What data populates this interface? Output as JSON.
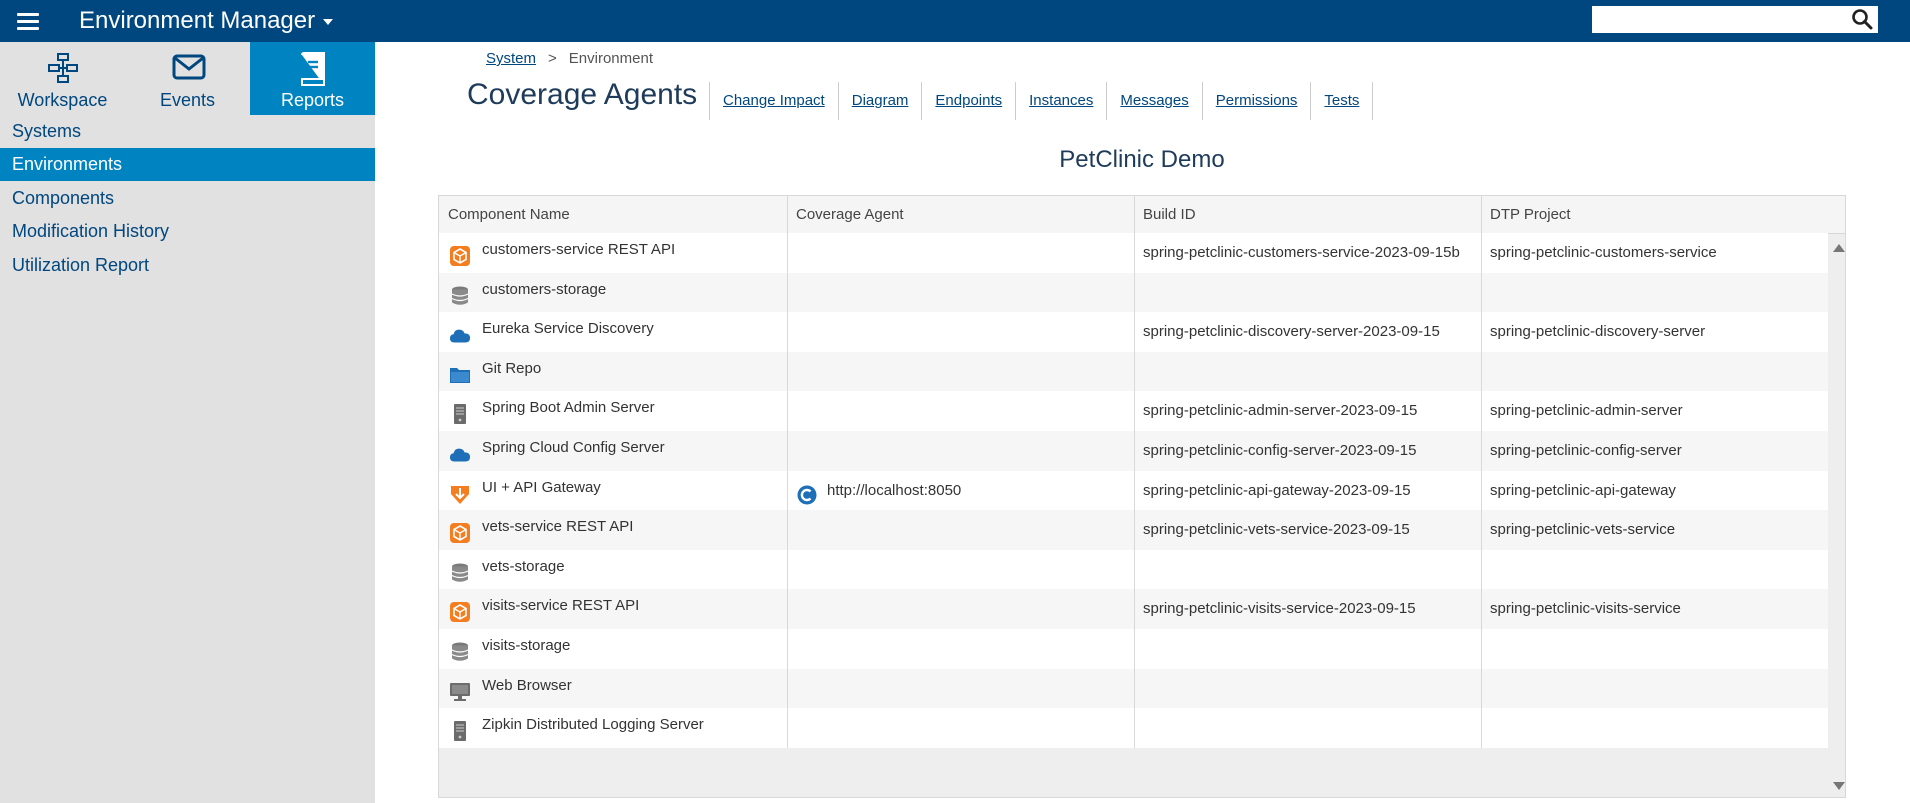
{
  "app": {
    "title": "Environment Manager",
    "search_placeholder": ""
  },
  "nav_tabs": [
    {
      "label": "Workspace",
      "icon": "workspace-diagram-icon"
    },
    {
      "label": "Events",
      "icon": "envelope-icon"
    },
    {
      "label": "Reports",
      "icon": "book-icon",
      "active": true
    }
  ],
  "sidebar_links": [
    {
      "label": "Systems"
    },
    {
      "label": "Environments",
      "active": true
    },
    {
      "label": "Components"
    },
    {
      "label": "Modification History"
    },
    {
      "label": "Utilization Report"
    }
  ],
  "breadcrumb": {
    "parent": "System",
    "separator": ">",
    "current": "Environment"
  },
  "page_title": "Coverage Agents",
  "subtabs": [
    "Change Impact",
    "Diagram",
    "Endpoints",
    "Instances",
    "Messages",
    "Permissions",
    "Tests"
  ],
  "environment_title": "PetClinic Demo",
  "table": {
    "columns": [
      "Component Name",
      "Coverage Agent",
      "Build ID",
      "DTP Project"
    ],
    "rows": [
      {
        "icon": "api-cube-icon",
        "name": "customers-service REST API",
        "agent": "",
        "build_id": "spring-petclinic-customers-service-2023-09-15b",
        "dtp_project": "spring-petclinic-customers-service"
      },
      {
        "icon": "database-icon",
        "name": "customers-storage",
        "agent": "",
        "build_id": "",
        "dtp_project": ""
      },
      {
        "icon": "cloud-icon",
        "name": "Eureka Service Discovery",
        "agent": "",
        "build_id": "spring-petclinic-discovery-server-2023-09-15",
        "dtp_project": "spring-petclinic-discovery-server"
      },
      {
        "icon": "folder-icon",
        "name": "Git Repo",
        "agent": "",
        "build_id": "",
        "dtp_project": ""
      },
      {
        "icon": "server-icon",
        "name": "Spring Boot Admin Server",
        "agent": "",
        "build_id": "spring-petclinic-admin-server-2023-09-15",
        "dtp_project": "spring-petclinic-admin-server"
      },
      {
        "icon": "cloud-icon",
        "name": "Spring Cloud Config Server",
        "agent": "",
        "build_id": "spring-petclinic-config-server-2023-09-15",
        "dtp_project": "spring-petclinic-config-server"
      },
      {
        "icon": "gateway-icon",
        "name": "UI + API Gateway",
        "agent": "http://localhost:8050",
        "build_id": "spring-petclinic-api-gateway-2023-09-15",
        "dtp_project": "spring-petclinic-api-gateway"
      },
      {
        "icon": "api-cube-icon",
        "name": "vets-service REST API",
        "agent": "",
        "build_id": "spring-petclinic-vets-service-2023-09-15",
        "dtp_project": "spring-petclinic-vets-service"
      },
      {
        "icon": "database-icon",
        "name": "vets-storage",
        "agent": "",
        "build_id": "",
        "dtp_project": ""
      },
      {
        "icon": "api-cube-icon",
        "name": "visits-service REST API",
        "agent": "",
        "build_id": "spring-petclinic-visits-service-2023-09-15",
        "dtp_project": "spring-petclinic-visits-service"
      },
      {
        "icon": "database-icon",
        "name": "visits-storage",
        "agent": "",
        "build_id": "",
        "dtp_project": ""
      },
      {
        "icon": "monitor-icon",
        "name": "Web Browser",
        "agent": "",
        "build_id": "",
        "dtp_project": ""
      },
      {
        "icon": "server-icon",
        "name": "Zipkin Distributed Logging Server",
        "agent": "",
        "build_id": "",
        "dtp_project": ""
      }
    ]
  },
  "colors": {
    "topbar": "#00467f",
    "accent": "#0083c1",
    "sidebar": "#e1e1e1",
    "api_orange": "#f47d20",
    "cloud_blue": "#1e6fb8"
  }
}
